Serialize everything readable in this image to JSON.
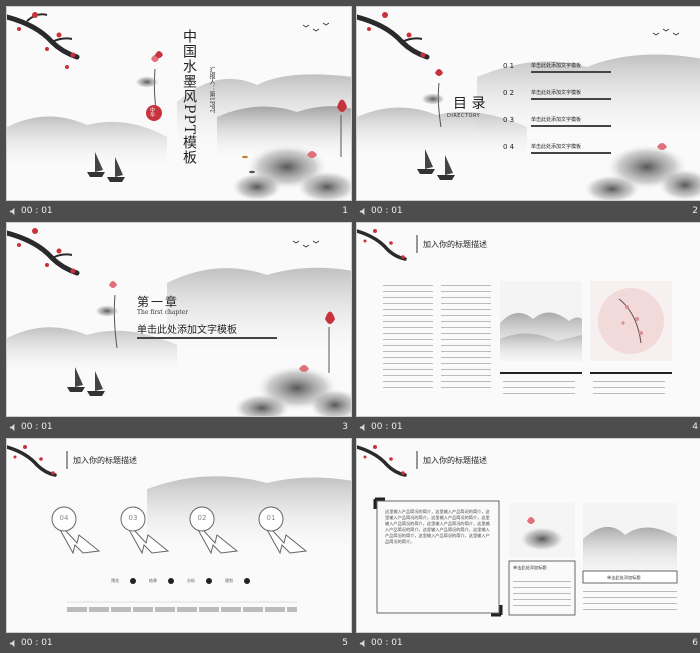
{
  "bar": {
    "time_icon": "speaker-icon",
    "colors": {
      "bar_bg": "#4d4d4d",
      "text": "#eeeeee"
    }
  },
  "slides": [
    {
      "time": "00 : 01",
      "number": "1",
      "title": "中国水墨风PPT模板",
      "subtitle": "汇报人：第1PPT",
      "seal": "中华"
    },
    {
      "time": "00 : 01",
      "number": "2",
      "heading": "目 录",
      "heading_en": "DIRECTORY",
      "items": [
        {
          "num": "0 1",
          "text": "单击此处添加文字模板"
        },
        {
          "num": "0 2",
          "text": "单击此处添加文字模板"
        },
        {
          "num": "0 3",
          "text": "单击此处添加文字模板"
        },
        {
          "num": "0 4",
          "text": "单击此处添加文字模板"
        }
      ]
    },
    {
      "time": "00 : 01",
      "number": "3",
      "chapter": "第一章",
      "chapter_en": "The first chapter",
      "subtitle": "单击此处添加文字模板"
    },
    {
      "time": "00 : 01",
      "number": "4",
      "title": "加入你的标题描述"
    },
    {
      "time": "00 : 01",
      "number": "5",
      "title": "加入你的标题描述",
      "steps": [
        {
          "num": "04"
        },
        {
          "num": "03"
        },
        {
          "num": "02"
        },
        {
          "num": "01"
        }
      ],
      "step_labels": [
        "预览",
        "结果",
        "分析",
        "规划"
      ]
    },
    {
      "time": "00 : 01",
      "number": "6",
      "title": "加入你的标题描述",
      "box_left_text": "这里输入产品简况的简介，这里输入产品简况的简介，这里输入产品简况的简介，这里输入产品简况的简介，这里输入产品简况的简介，这里输入产品简况的简介，这里输入产品简况的简介，这里输入产品简况的简介，这里输入产品简况的简介，这里输入产品简况的简介，这里输入产品简况的简介。",
      "card1_title": "单击此处添加标题",
      "card2_title": "单击此处添加标题"
    }
  ]
}
